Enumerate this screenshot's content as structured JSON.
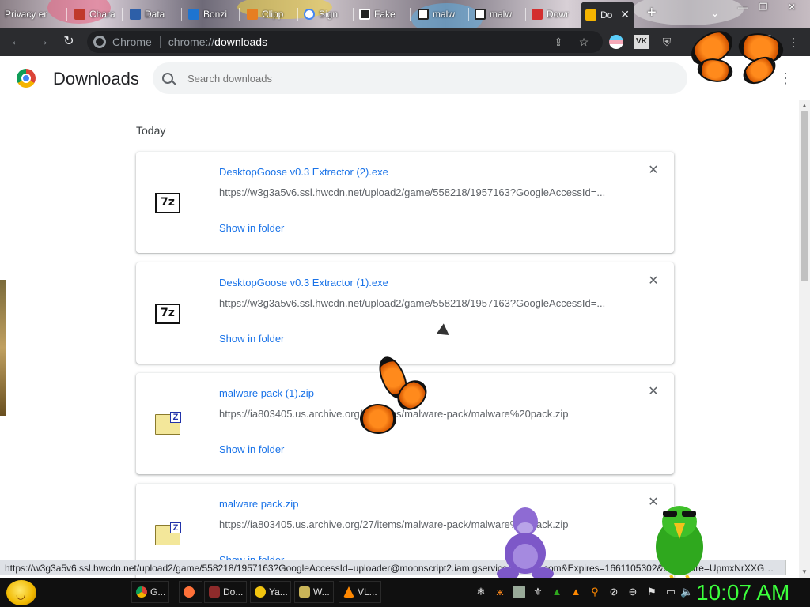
{
  "tabs": [
    {
      "label": "Privacy er",
      "color": "#6b6b6b"
    },
    {
      "label": "Chara",
      "color": "#c0392b"
    },
    {
      "label": "Data",
      "color": "#2d5fa8"
    },
    {
      "label": "Bonzi",
      "color": "#1e74d0"
    },
    {
      "label": "Clipp",
      "color": "#e67e22"
    },
    {
      "label": "Sign",
      "color": "#4285f4"
    },
    {
      "label": "Fake",
      "color": "#222222"
    },
    {
      "label": "malw",
      "color": "#222222"
    },
    {
      "label": "malw",
      "color": "#222222"
    },
    {
      "label": "Dowr",
      "color": "#d32f2f"
    },
    {
      "label": "Do",
      "color": "#f4b400",
      "active": true
    }
  ],
  "toolbar": {
    "omnibox_label": "Chrome",
    "url_scheme": "chrome://",
    "url_host": "downloads",
    "icons": [
      "share-icon",
      "bookmark-star-icon",
      "extension-flag-icon",
      "extension-vk-icon",
      "ublock-icon",
      "profile-avatar-icon",
      "kebab-menu-icon"
    ]
  },
  "page": {
    "title": "Downloads",
    "search_placeholder": "Search downloads",
    "section_date": "Today",
    "downloads": [
      {
        "filename": "DesktopGoose v0.3 Extractor (2).exe",
        "url": "https://w3g3a5v6.ssl.hwcdn.net/upload2/game/558218/1957163?GoogleAccessId=...",
        "action": "Show in folder",
        "icon": "7z-icon"
      },
      {
        "filename": "DesktopGoose v0.3 Extractor (1).exe",
        "url": "https://w3g3a5v6.ssl.hwcdn.net/upload2/game/558218/1957163?GoogleAccessId=...",
        "action": "Show in folder",
        "icon": "7z-icon"
      },
      {
        "filename": "malware pack (1).zip",
        "url": "https://ia803405.us.archive.org/27/items/malware-pack/malware%20pack.zip",
        "action": "Show in folder",
        "icon": "zip-icon"
      },
      {
        "filename": "malware pack.zip",
        "url": "https://ia803405.us.archive.org/27/items/malware-pack/malware%20pack.zip",
        "action": "Show in folder",
        "icon": "zip-icon"
      }
    ],
    "status_url": "https://w3g3a5v6.ssl.hwcdn.net/upload2/game/558218/1957163?GoogleAccessId=uploader@moonscript2.iam.gserviceaccount.com&Expires=1661105302&Signature=UpmxNrXXGmzL..."
  },
  "taskbar": {
    "tasks": [
      {
        "label": "G...",
        "color": "#4285f4"
      },
      {
        "label": "",
        "color": "#ff7139"
      },
      {
        "label": "Do...",
        "color": "#8e2b2b"
      },
      {
        "label": "Ya...",
        "color": "#f1c40f"
      },
      {
        "label": "W...",
        "color": "#c9b458"
      },
      {
        "label": "VL...",
        "color": "#ff8800"
      }
    ],
    "clock": "10:07 AM"
  }
}
